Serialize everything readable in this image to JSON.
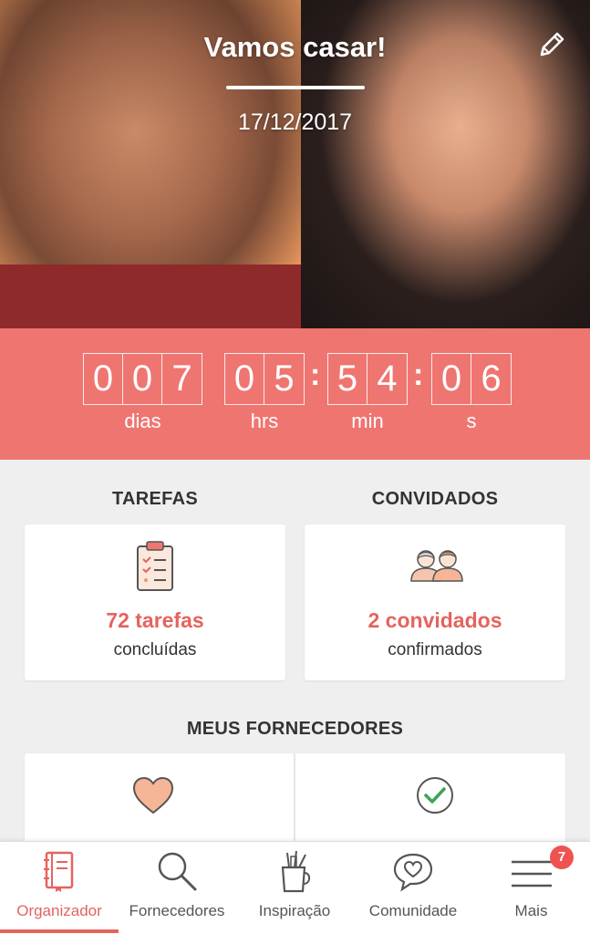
{
  "header": {
    "title": "Vamos casar!",
    "date": "17/12/2017"
  },
  "countdown": {
    "days_digits": [
      "0",
      "0",
      "7"
    ],
    "hours_digits": [
      "0",
      "5"
    ],
    "minutes_digits": [
      "5",
      "4"
    ],
    "seconds_digits": [
      "0",
      "6"
    ],
    "separator": ":",
    "labels": {
      "days": "dias",
      "hours": "hrs",
      "minutes": "min",
      "seconds": "s"
    }
  },
  "sections": {
    "tasks_title": "TAREFAS",
    "guests_title": "CONVIDADOS",
    "vendors_title": "MEUS FORNECEDORES"
  },
  "tasks_card": {
    "count": "72 tarefas",
    "status": "concluídas",
    "icon": "clipboard-checklist-icon"
  },
  "guests_card": {
    "count": "2 convidados",
    "status": "confirmados",
    "icon": "couple-icon"
  },
  "vendors": [
    {
      "icon": "heart-icon",
      "color": "#f6b597"
    },
    {
      "icon": "check-circle-icon",
      "color": "#3aa655"
    }
  ],
  "bottom_nav": {
    "items": [
      {
        "label": "Organizador",
        "icon": "notebook-icon",
        "active": true
      },
      {
        "label": "Fornecedores",
        "icon": "search-icon",
        "active": false
      },
      {
        "label": "Inspiração",
        "icon": "pencil-cup-icon",
        "active": false
      },
      {
        "label": "Comunidade",
        "icon": "chat-heart-icon",
        "active": false
      },
      {
        "label": "Mais",
        "icon": "menu-icon",
        "active": false
      }
    ],
    "badge_count": "7"
  },
  "colors": {
    "accent": "#ef7571",
    "accent_text": "#e5635e",
    "background": "#efefef"
  }
}
